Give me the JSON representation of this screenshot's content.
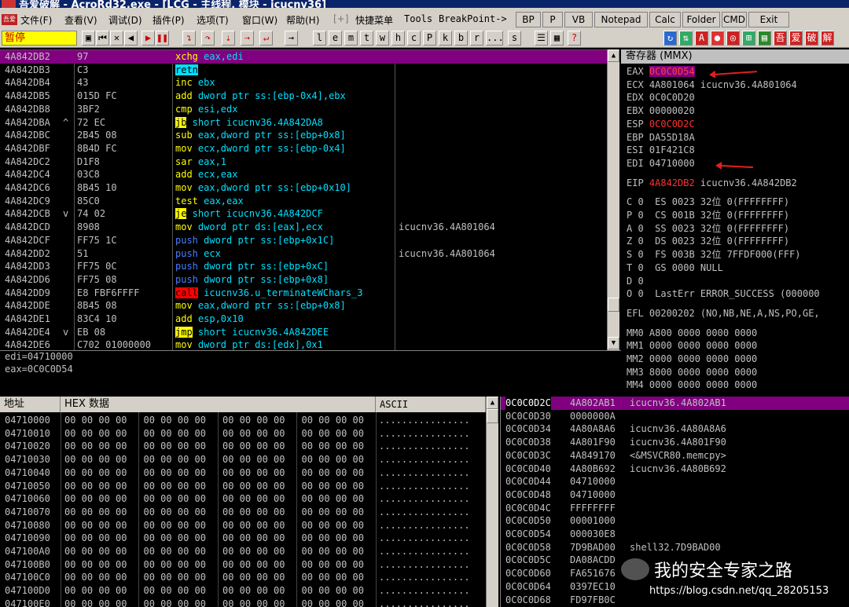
{
  "window": {
    "title": "吾爱破解 - AcroRd32.exe - [LCG - 主线程, 模块 - icucnv36]",
    "app_icon_text": "吾爱"
  },
  "menu": {
    "items": [
      "文件(F)",
      "查看(V)",
      "调试(D)",
      "插件(P)",
      "选项(T)",
      "窗口(W)",
      "帮助(H)",
      "[+]",
      "快捷菜单",
      "Tools",
      "BreakPoint->"
    ],
    "buttons": [
      "BP",
      "P",
      "VB",
      "Notepad",
      "Calc",
      "Folder",
      "CMD",
      "Exit"
    ]
  },
  "toolbar": {
    "status": "暂停",
    "letters": [
      "l",
      "e",
      "m",
      "t",
      "w",
      "h",
      "c",
      "P",
      "k",
      "b",
      "r",
      "...",
      "s"
    ]
  },
  "cpu": {
    "rows": [
      {
        "addr": "4A842DB2",
        "mark": " ",
        "hex": "97",
        "mn": "xchg",
        "mnc": "yellow",
        "ops": "eax,edi",
        "cmt": ""
      },
      {
        "addr": "4A842DB3",
        "mark": " ",
        "hex": "C3",
        "mn": "retn",
        "mnc": "boxg",
        "ops": "",
        "cmt": ""
      },
      {
        "addr": "4A842DB4",
        "mark": " ",
        "hex": "43",
        "mn": "inc",
        "mnc": "yellow",
        "ops": "ebx",
        "cmt": ""
      },
      {
        "addr": "4A842DB5",
        "mark": " ",
        "hex": "015D FC",
        "mn": "add",
        "mnc": "yellow",
        "ops": "dword ptr ss:[ebp-0x4],ebx",
        "cmt": ""
      },
      {
        "addr": "4A842DB8",
        "mark": " ",
        "hex": "3BF2",
        "mn": "cmp",
        "mnc": "yellow",
        "ops": "esi,edx",
        "cmt": ""
      },
      {
        "addr": "4A842DBA",
        "mark": "^",
        "hex": "72 EC",
        "mn": "jb",
        "mnc": "boxy",
        "ops": "short icucnv36.4A842DA8",
        "cmt": ""
      },
      {
        "addr": "4A842DBC",
        "mark": " ",
        "hex": "2B45 08",
        "mn": "sub",
        "mnc": "yellow",
        "ops": "eax,dword ptr ss:[ebp+0x8]",
        "cmt": ""
      },
      {
        "addr": "4A842DBF",
        "mark": " ",
        "hex": "8B4D FC",
        "mn": "mov",
        "mnc": "yellow",
        "ops": "ecx,dword ptr ss:[ebp-0x4]",
        "cmt": ""
      },
      {
        "addr": "4A842DC2",
        "mark": " ",
        "hex": "D1F8",
        "mn": "sar",
        "mnc": "yellow",
        "ops": "eax,1",
        "cmt": ""
      },
      {
        "addr": "4A842DC4",
        "mark": " ",
        "hex": "03C8",
        "mn": "add",
        "mnc": "yellow",
        "ops": "ecx,eax",
        "cmt": ""
      },
      {
        "addr": "4A842DC6",
        "mark": " ",
        "hex": "8B45 10",
        "mn": "mov",
        "mnc": "yellow",
        "ops": "eax,dword ptr ss:[ebp+0x10]",
        "cmt": ""
      },
      {
        "addr": "4A842DC9",
        "mark": " ",
        "hex": "85C0",
        "mn": "test",
        "mnc": "yellow",
        "ops": "eax,eax",
        "cmt": ""
      },
      {
        "addr": "4A842DCB",
        "mark": "v",
        "hex": "74 02",
        "mn": "je",
        "mnc": "boxy",
        "ops": "short icucnv36.4A842DCF",
        "cmt": ""
      },
      {
        "addr": "4A842DCD",
        "mark": " ",
        "hex": "8908",
        "mn": "mov",
        "mnc": "yellow",
        "ops": "dword ptr ds:[eax],ecx",
        "cmt": "icucnv36.4A801064"
      },
      {
        "addr": "4A842DCF",
        "mark": " ",
        "hex": "FF75 1C",
        "mn": "push",
        "mnc": "blue",
        "ops": "dword ptr ss:[ebp+0x1C]",
        "cmt": ""
      },
      {
        "addr": "4A842DD2",
        "mark": " ",
        "hex": "51",
        "mn": "push",
        "mnc": "blue",
        "ops": "ecx",
        "cmt": "icucnv36.4A801064"
      },
      {
        "addr": "4A842DD3",
        "mark": " ",
        "hex": "FF75 0C",
        "mn": "push",
        "mnc": "blue",
        "ops": "dword ptr ss:[ebp+0xC]",
        "cmt": ""
      },
      {
        "addr": "4A842DD6",
        "mark": " ",
        "hex": "FF75 08",
        "mn": "push",
        "mnc": "blue",
        "ops": "dword ptr ss:[ebp+0x8]",
        "cmt": ""
      },
      {
        "addr": "4A842DD9",
        "mark": " ",
        "hex": "E8 FBF6FFFF",
        "mn": "call",
        "mnc": "boxr",
        "ops": "icucnv36.u_terminateWChars_3",
        "cmt": ""
      },
      {
        "addr": "4A842DDE",
        "mark": " ",
        "hex": "8B45 08",
        "mn": "mov",
        "mnc": "yellow",
        "ops": "eax,dword ptr ss:[ebp+0x8]",
        "cmt": ""
      },
      {
        "addr": "4A842DE1",
        "mark": " ",
        "hex": "83C4 10",
        "mn": "add",
        "mnc": "yellow",
        "ops": "esp,0x10",
        "cmt": ""
      },
      {
        "addr": "4A842DE4",
        "mark": "v",
        "hex": "EB 08",
        "mn": "jmp",
        "mnc": "boxy",
        "ops": "short icucnv36.4A842DEE",
        "cmt": ""
      },
      {
        "addr": "4A842DE6",
        "mark": " ",
        "hex": "C702 01000000",
        "mn": "mov",
        "mnc": "yellow",
        "ops": "dword ptr ds:[edx],0x1",
        "cmt": ""
      }
    ]
  },
  "info": {
    "lines": [
      "edi=04710000",
      "eax=0C0C0D54"
    ]
  },
  "registers": {
    "title": "寄存器 (MMX)",
    "gp": [
      {
        "name": "EAX",
        "value": "0C0C0D54",
        "extra": "",
        "style": "hlpurple"
      },
      {
        "name": "ECX",
        "value": "4A801064",
        "extra": "icucnv36.4A801064",
        "style": ""
      },
      {
        "name": "EDX",
        "value": "0C0C0D20",
        "extra": "",
        "style": ""
      },
      {
        "name": "EBX",
        "value": "00000020",
        "extra": "",
        "style": ""
      },
      {
        "name": "ESP",
        "value": "0C0C0D2C",
        "extra": "",
        "style": "red"
      },
      {
        "name": "EBP",
        "value": "DA55D18A",
        "extra": "",
        "style": ""
      },
      {
        "name": "ESI",
        "value": "01F421C8",
        "extra": "",
        "style": ""
      },
      {
        "name": "EDI",
        "value": "04710000",
        "extra": "",
        "style": ""
      }
    ],
    "eip": {
      "name": "EIP",
      "value": "4A842DB2",
      "extra": "icucnv36.4A842DB2"
    },
    "flags": [
      "C 0  ES 0023 32位 0(FFFFFFFF)",
      "P 0  CS 001B 32位 0(FFFFFFFF)",
      "A 0  SS 0023 32位 0(FFFFFFFF)",
      "Z 0  DS 0023 32位 0(FFFFFFFF)",
      "S 0  FS 003B 32位 7FFDF000(FFF)",
      "T 0  GS 0000 NULL",
      "D 0",
      "O 0  LastErr ERROR_SUCCESS (000000"
    ],
    "efl": "EFL 00200202 (NO,NB,NE,A,NS,PO,GE,",
    "mmx": [
      "MM0 A800 0000 0000 0000",
      "MM1 0000 0000 0000 0000",
      "MM2 0000 0000 0000 0000",
      "MM3 8000 0000 0000 0000",
      "MM4 0000 0000 0000 0000"
    ]
  },
  "dump": {
    "headers": {
      "addr": "地址",
      "hex": "HEX 数据",
      "ascii": "ASCII"
    },
    "addresses": [
      "04710000",
      "04710010",
      "04710020",
      "04710030",
      "04710040",
      "04710050",
      "04710060",
      "04710070",
      "04710080",
      "04710090",
      "047100A0",
      "047100B0",
      "047100C0",
      "047100D0",
      "047100E0"
    ],
    "hex": "00 00 00 00 00 00 00 00 00 00 00 00 00 00 00 00",
    "ascii": "................"
  },
  "stack": {
    "rows": [
      {
        "addr": "0C0C0D2C",
        "val": "4A802AB1",
        "cmt": "icucnv36.4A802AB1",
        "hl": true
      },
      {
        "addr": "0C0C0D30",
        "val": "0000000A",
        "cmt": "",
        "hl": false
      },
      {
        "addr": "0C0C0D34",
        "val": "4A80A8A6",
        "cmt": "icucnv36.4A80A8A6",
        "hl": false
      },
      {
        "addr": "0C0C0D38",
        "val": "4A801F90",
        "cmt": "icucnv36.4A801F90",
        "hl": false
      },
      {
        "addr": "0C0C0D3C",
        "val": "4A849170",
        "cmt": "<&MSVCR80.memcpy>",
        "hl": false
      },
      {
        "addr": "0C0C0D40",
        "val": "4A80B692",
        "cmt": "icucnv36.4A80B692",
        "hl": false
      },
      {
        "addr": "0C0C0D44",
        "val": "04710000",
        "cmt": "",
        "hl": false
      },
      {
        "addr": "0C0C0D48",
        "val": "04710000",
        "cmt": "",
        "hl": false
      },
      {
        "addr": "0C0C0D4C",
        "val": "FFFFFFFF",
        "cmt": "",
        "hl": false
      },
      {
        "addr": "0C0C0D50",
        "val": "00001000",
        "cmt": "",
        "hl": false
      },
      {
        "addr": "0C0C0D54",
        "val": "000030E8",
        "cmt": "",
        "hl": false
      },
      {
        "addr": "0C0C0D58",
        "val": "7D9BAD00",
        "cmt": "shell32.7D9BAD00",
        "hl": false
      },
      {
        "addr": "0C0C0D5C",
        "val": "DA08ACDD",
        "cmt": "",
        "hl": false
      },
      {
        "addr": "0C0C0D60",
        "val": "FA651676",
        "cmt": "",
        "hl": false
      },
      {
        "addr": "0C0C0D64",
        "val": "0397EC10",
        "cmt": "",
        "hl": false
      },
      {
        "addr": "0C0C0D68",
        "val": "FD97FB0C",
        "cmt": "",
        "hl": false
      }
    ]
  },
  "watermark": {
    "title": "我的安全专家之路",
    "url": "https://blog.csdn.net/qq_28205153"
  },
  "colors": {
    "highlight": "#800080",
    "mnemonic": "#ffff00",
    "operand": "#00e0ff",
    "register_changed": "#ff3030",
    "arrow": "#e02020"
  }
}
